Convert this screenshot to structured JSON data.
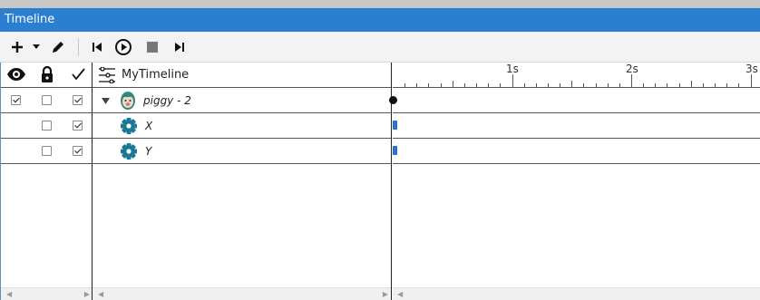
{
  "window": {
    "title": "Timeline"
  },
  "toolbar": {
    "add_icon": "plus-icon",
    "dropdown_icon": "caret-down-icon",
    "edit_icon": "pencil-icon",
    "first_icon": "skip-to-start-icon",
    "play_icon": "play-circle-icon",
    "stop_icon": "stop-icon",
    "last_icon": "skip-to-end-icon"
  },
  "columns": {
    "visibility_icon": "eye-icon",
    "lock_icon": "lock-icon",
    "enabled_icon": "checkmark-icon"
  },
  "timeline": {
    "name": "MyTimeline",
    "icon": "timeline-icon"
  },
  "rows": [
    {
      "label": "piggy - 2",
      "icon": "piggy-avatar-icon",
      "visible": true,
      "locked": false,
      "enabled": true,
      "expanded": true
    },
    {
      "label": "X",
      "icon": "gear-icon",
      "locked": false,
      "enabled": true
    },
    {
      "label": "Y",
      "icon": "gear-icon",
      "locked": false,
      "enabled": true
    }
  ],
  "ruler": {
    "labels": [
      "1s",
      "2s",
      "3s"
    ]
  },
  "colors": {
    "titlebar": "#2b7fd0",
    "gear": "#1a7a96",
    "keyframe": "#2f6fd0"
  }
}
